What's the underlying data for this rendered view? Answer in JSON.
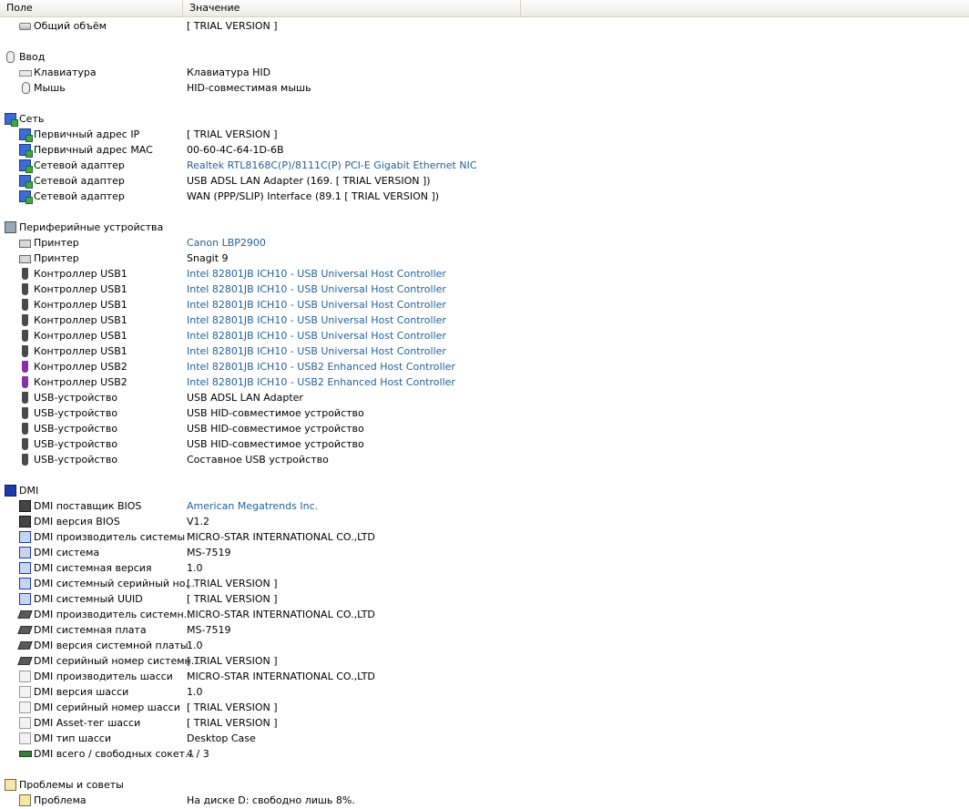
{
  "header": {
    "field": "Поле",
    "value": "Значение"
  },
  "rows": [
    {
      "type": "item",
      "icon": "drive-icon",
      "cls": "i-drive",
      "field": "Общий объём",
      "value": "[ TRIAL VERSION ]"
    },
    {
      "type": "spacer"
    },
    {
      "type": "group",
      "icon": "input-icon",
      "cls": "i-input",
      "field": "Ввод"
    },
    {
      "type": "item",
      "icon": "keyboard-icon",
      "cls": "i-keyboard",
      "field": "Клавиатура",
      "value": "Клавиатура HID"
    },
    {
      "type": "item",
      "icon": "mouse-icon",
      "cls": "i-mouse",
      "field": "Мышь",
      "value": "HID-совместимая мышь"
    },
    {
      "type": "spacer"
    },
    {
      "type": "group",
      "icon": "network-icon",
      "cls": "i-network",
      "field": "Сеть"
    },
    {
      "type": "item",
      "icon": "network-icon",
      "cls": "i-network",
      "field": "Первичный адрес IP",
      "value": "[ TRIAL VERSION ]"
    },
    {
      "type": "item",
      "icon": "network-icon",
      "cls": "i-network",
      "field": "Первичный адрес MAC",
      "value": "00-60-4C-64-1D-6B"
    },
    {
      "type": "item",
      "icon": "network-icon",
      "cls": "i-network",
      "field": "Сетевой адаптер",
      "value": "Realtek RTL8168C(P)/8111C(P) PCI-E Gigabit Ethernet NIC",
      "link": true
    },
    {
      "type": "item",
      "icon": "network-icon",
      "cls": "i-network",
      "field": "Сетевой адаптер",
      "value": "USB ADSL LAN Adapter  (169. [ TRIAL VERSION ])"
    },
    {
      "type": "item",
      "icon": "network-icon",
      "cls": "i-network",
      "field": "Сетевой адаптер",
      "value": "WAN (PPP/SLIP) Interface  (89.1 [ TRIAL VERSION ])"
    },
    {
      "type": "spacer"
    },
    {
      "type": "group",
      "icon": "peripherals-icon",
      "cls": "i-periph",
      "field": "Периферийные устройства"
    },
    {
      "type": "item",
      "icon": "printer-icon",
      "cls": "i-printer",
      "field": "Принтер",
      "value": "Canon LBP2900",
      "link": true
    },
    {
      "type": "item",
      "icon": "printer-icon",
      "cls": "i-printer",
      "field": "Принтер",
      "value": "Snagit 9"
    },
    {
      "type": "item",
      "icon": "usb-plug-icon",
      "cls": "i-usb",
      "field": "Контроллер USB1",
      "value": "Intel 82801JB ICH10 - USB Universal Host Controller",
      "link": true
    },
    {
      "type": "item",
      "icon": "usb-plug-icon",
      "cls": "i-usb",
      "field": "Контроллер USB1",
      "value": "Intel 82801JB ICH10 - USB Universal Host Controller",
      "link": true
    },
    {
      "type": "item",
      "icon": "usb-plug-icon",
      "cls": "i-usb",
      "field": "Контроллер USB1",
      "value": "Intel 82801JB ICH10 - USB Universal Host Controller",
      "link": true
    },
    {
      "type": "item",
      "icon": "usb-plug-icon",
      "cls": "i-usb",
      "field": "Контроллер USB1",
      "value": "Intel 82801JB ICH10 - USB Universal Host Controller",
      "link": true
    },
    {
      "type": "item",
      "icon": "usb-plug-icon",
      "cls": "i-usb",
      "field": "Контроллер USB1",
      "value": "Intel 82801JB ICH10 - USB Universal Host Controller",
      "link": true
    },
    {
      "type": "item",
      "icon": "usb-plug-icon",
      "cls": "i-usb",
      "field": "Контроллер USB1",
      "value": "Intel 82801JB ICH10 - USB Universal Host Controller",
      "link": true
    },
    {
      "type": "item",
      "icon": "usb2-plug-icon",
      "cls": "i-usb2",
      "field": "Контроллер USB2",
      "value": "Intel 82801JB ICH10 - USB2 Enhanced Host Controller",
      "link": true
    },
    {
      "type": "item",
      "icon": "usb2-plug-icon",
      "cls": "i-usb2",
      "field": "Контроллер USB2",
      "value": "Intel 82801JB ICH10 - USB2 Enhanced Host Controller",
      "link": true
    },
    {
      "type": "item",
      "icon": "usb-plug-icon",
      "cls": "i-usb",
      "field": "USB-устройство",
      "value": "USB ADSL LAN Adapter"
    },
    {
      "type": "item",
      "icon": "usb-plug-icon",
      "cls": "i-usb",
      "field": "USB-устройство",
      "value": "USB HID-совместимое устройство"
    },
    {
      "type": "item",
      "icon": "usb-plug-icon",
      "cls": "i-usb",
      "field": "USB-устройство",
      "value": "USB HID-совместимое устройство"
    },
    {
      "type": "item",
      "icon": "usb-plug-icon",
      "cls": "i-usb",
      "field": "USB-устройство",
      "value": "USB HID-совместимое устройство"
    },
    {
      "type": "item",
      "icon": "usb-plug-icon",
      "cls": "i-usb",
      "field": "USB-устройство",
      "value": "Составное USB устройство"
    },
    {
      "type": "spacer"
    },
    {
      "type": "group",
      "icon": "dmi-icon",
      "cls": "i-dmi",
      "field": "DMI"
    },
    {
      "type": "item",
      "icon": "bios-chip-icon",
      "cls": "i-chip",
      "field": "DMI поставщик BIOS",
      "value": "American Megatrends Inc.",
      "link": true
    },
    {
      "type": "item",
      "icon": "bios-chip-icon",
      "cls": "i-chip",
      "field": "DMI версия BIOS",
      "value": "V1.2"
    },
    {
      "type": "item",
      "icon": "computer-icon",
      "cls": "i-pc",
      "field": "DMI производитель системы",
      "value": "MICRO-STAR INTERNATIONAL CO.,LTD"
    },
    {
      "type": "item",
      "icon": "computer-icon",
      "cls": "i-pc",
      "field": "DMI система",
      "value": "MS-7519"
    },
    {
      "type": "item",
      "icon": "computer-icon",
      "cls": "i-pc",
      "field": "DMI системная версия",
      "value": "1.0"
    },
    {
      "type": "item",
      "icon": "computer-icon",
      "cls": "i-pc",
      "field": "DMI системный серийный но...",
      "value": "[ TRIAL VERSION ]"
    },
    {
      "type": "item",
      "icon": "computer-icon",
      "cls": "i-pc",
      "field": "DMI системный UUID",
      "value": "[ TRIAL VERSION ]"
    },
    {
      "type": "item",
      "icon": "motherboard-icon",
      "cls": "i-board",
      "field": "DMI производитель системн...",
      "value": "MICRO-STAR INTERNATIONAL CO.,LTD"
    },
    {
      "type": "item",
      "icon": "motherboard-icon",
      "cls": "i-board",
      "field": "DMI системная плата",
      "value": "MS-7519"
    },
    {
      "type": "item",
      "icon": "motherboard-icon",
      "cls": "i-board",
      "field": "DMI версия системной платы",
      "value": "1.0"
    },
    {
      "type": "item",
      "icon": "motherboard-icon",
      "cls": "i-board",
      "field": "DMI серийный номер системн...",
      "value": "[ TRIAL VERSION ]"
    },
    {
      "type": "item",
      "icon": "chassis-icon",
      "cls": "i-case",
      "field": "DMI производитель шасси",
      "value": "MICRO-STAR INTERNATIONAL CO.,LTD"
    },
    {
      "type": "item",
      "icon": "chassis-icon",
      "cls": "i-case",
      "field": "DMI версия шасси",
      "value": "1.0"
    },
    {
      "type": "item",
      "icon": "chassis-icon",
      "cls": "i-case",
      "field": "DMI серийный номер шасси",
      "value": "[ TRIAL VERSION ]"
    },
    {
      "type": "item",
      "icon": "chassis-icon",
      "cls": "i-case",
      "field": "DMI Asset-тег шасси",
      "value": "[ TRIAL VERSION ]"
    },
    {
      "type": "item",
      "icon": "chassis-icon",
      "cls": "i-case",
      "field": "DMI тип шасси",
      "value": "Desktop Case"
    },
    {
      "type": "item",
      "icon": "memory-slot-icon",
      "cls": "i-slot",
      "field": "DMI всего / свободных сокет...",
      "value": "4 / 3"
    },
    {
      "type": "spacer"
    },
    {
      "type": "group",
      "icon": "problems-icon",
      "cls": "i-problems",
      "field": "Проблемы и советы"
    },
    {
      "type": "item",
      "icon": "problem-icon",
      "cls": "i-problem",
      "field": "Проблема",
      "value": "На диске D: свободно лишь 8%."
    }
  ]
}
